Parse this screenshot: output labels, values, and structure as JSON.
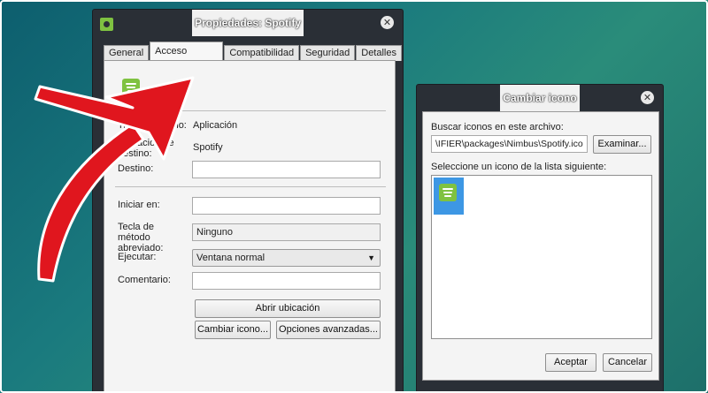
{
  "props_window": {
    "title": "Propiedades: Spotify",
    "tabs": [
      {
        "label": "General",
        "active": false
      },
      {
        "label": "Acceso directo",
        "active": true
      },
      {
        "label": "Compatibilidad",
        "active": false
      },
      {
        "label": "Seguridad",
        "active": false
      },
      {
        "label": "Detalles",
        "active": false
      }
    ],
    "fields": {
      "type_label": "Tipo de destino:",
      "type_value": "Aplicación",
      "location_label": "Ubicación de destino:",
      "location_value": "Spotify",
      "target_label": "Destino:",
      "target_value": "",
      "start_in_label": "Iniciar en:",
      "start_in_value": "",
      "shortcut_key_label": "Tecla de método abreviado:",
      "shortcut_key_value": "Ninguno",
      "run_label": "Ejecutar:",
      "run_value": "Ventana normal",
      "comment_label": "Comentario:",
      "comment_value": ""
    },
    "buttons": {
      "open_location": "Abrir ubicación",
      "change_icon": "Cambiar icono...",
      "advanced_options": "Opciones avanzadas..."
    }
  },
  "change_icon_dialog": {
    "title": "Cambiar icono",
    "search_label": "Buscar iconos en este archivo:",
    "search_value": "\\IFIER\\packages\\Nimbus\\Spotify.ico",
    "browse_button": "Examinar...",
    "list_label": "Seleccione un icono de la lista siguiente:",
    "ok_button": "Aceptar",
    "cancel_button": "Cancelar"
  },
  "colors": {
    "desktop": "#1a7a7e",
    "window_frame": "#2a2f36",
    "spotify_green": "#7fc241",
    "selection_blue": "#3d97e4",
    "arrow_red": "#e0161e"
  },
  "icons": {
    "close": "close-icon",
    "app": "spotify-app-icon",
    "arrow": "red-annotation-arrow"
  }
}
